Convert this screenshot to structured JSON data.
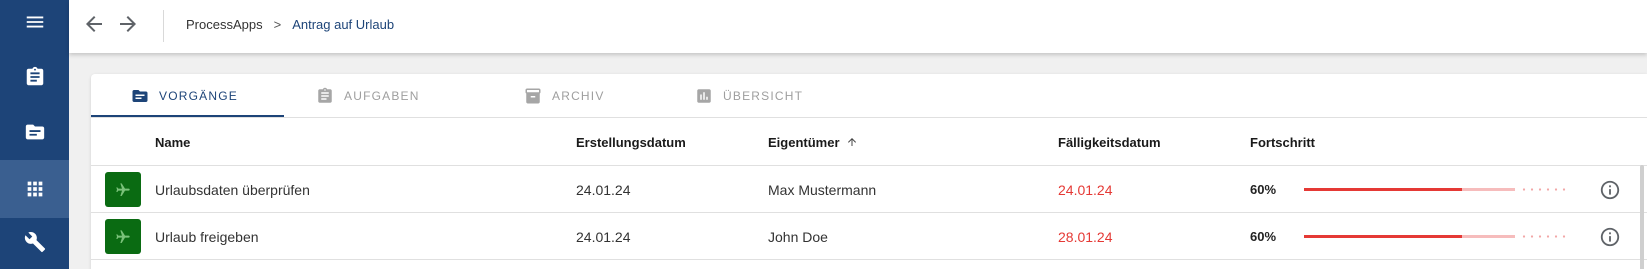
{
  "sidebar": {
    "items": [
      {
        "icon": "menu-icon"
      },
      {
        "icon": "clipboard-icon"
      },
      {
        "icon": "folder-list-icon"
      },
      {
        "icon": "apps-grid-icon",
        "active": true
      },
      {
        "icon": "wrench-icon"
      }
    ],
    "colors": {
      "background": "#1d4478",
      "active": "#3a5f90"
    }
  },
  "header": {
    "back_icon": "arrow-left-icon",
    "forward_icon": "arrow-right-icon",
    "breadcrumb": {
      "root": "ProcessApps",
      "separator": ">",
      "current": "Antrag auf Urlaub"
    }
  },
  "tabs": [
    {
      "label": "VORGÄNGE",
      "icon": "folder-list-icon",
      "active": true
    },
    {
      "label": "AUFGABEN",
      "icon": "clipboard-icon",
      "active": false
    },
    {
      "label": "ARCHIV",
      "icon": "archive-icon",
      "active": false
    },
    {
      "label": "ÜBERSICHT",
      "icon": "bar-chart-icon",
      "active": false
    }
  ],
  "table": {
    "columns": {
      "name": "Name",
      "created": "Erstellungsdatum",
      "owner": "Eigentümer",
      "due": "Fälligkeitsdatum",
      "progress": "Fortschritt"
    },
    "sort": {
      "column": "owner",
      "direction": "ascending",
      "icon": "arrow-up-icon"
    },
    "rows": [
      {
        "icon": "airplane-icon",
        "name": "Urlaubsdaten überprüfen",
        "created": "24.01.24",
        "owner": "Max Mustermann",
        "due": "24.01.24",
        "progress_label": "60%",
        "progress": 0.6,
        "buffer": 0.8,
        "info_icon": "info-icon"
      },
      {
        "icon": "airplane-icon",
        "name": "Urlaub freigeben",
        "created": "24.01.24",
        "owner": "John Doe",
        "due": "28.01.24",
        "progress_label": "60%",
        "progress": 0.6,
        "buffer": 0.8,
        "info_icon": "info-icon"
      }
    ]
  },
  "colors": {
    "accent": "#1d4478",
    "overdue": "#e53935",
    "badge": "#0a6b12",
    "progress": "#e53935"
  }
}
